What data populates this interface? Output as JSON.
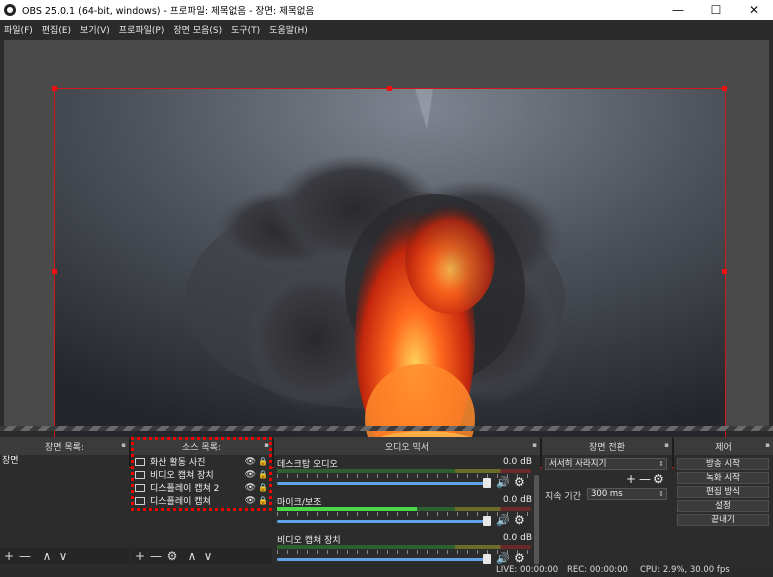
{
  "window": {
    "title": "OBS 25.0.1 (64-bit, windows) - 프로파일: 제목없음 - 장면: 제목없음",
    "minimize_glyph": "—",
    "maximize_glyph": "☐",
    "close_glyph": "✕"
  },
  "menu": [
    {
      "label": "파일(F)"
    },
    {
      "label": "편집(E)"
    },
    {
      "label": "보기(V)"
    },
    {
      "label": "프로파일(P)"
    },
    {
      "label": "장면 모음(S)"
    },
    {
      "label": "도구(T)"
    },
    {
      "label": "도움말(H)"
    }
  ],
  "preview": {
    "content": "volcano eruption photo"
  },
  "docks": {
    "scenes": {
      "header": "장면 목록:",
      "items": [
        "장면"
      ],
      "footer_add": "+",
      "footer_remove": "—",
      "footer_up": "∧",
      "footer_down": "∨"
    },
    "sources": {
      "header": "소스 목록:",
      "items": [
        {
          "label": "화산 활동 사진",
          "icon": "image-icon"
        },
        {
          "label": "비디오 캡쳐 장치",
          "icon": "camera-icon"
        },
        {
          "label": "디스플레이 캡쳐 2",
          "icon": "monitor-icon"
        },
        {
          "label": "디스플레이 캡쳐",
          "icon": "monitor-icon"
        }
      ],
      "footer_add": "+",
      "footer_remove": "—",
      "footer_settings": "⚙",
      "footer_up": "∧",
      "footer_down": "∨"
    },
    "mixer": {
      "header": "오디오 믹서",
      "channels": [
        {
          "name": "데스크탑 오디오",
          "db": "0.0 dB",
          "level": 0.0
        },
        {
          "name": "마이크/보조",
          "db": "0.0 dB",
          "level": 0.55
        },
        {
          "name": "비디오 캡쳐 장치",
          "db": "0.0 dB",
          "level": 0.0
        }
      ]
    },
    "transitions": {
      "header": "장면 전환",
      "selected": "서서히 사라지기",
      "duration_label": "지속 기간",
      "duration_value": "300 ms",
      "add": "+",
      "remove": "—",
      "settings": "⚙"
    },
    "controls": {
      "header": "제어",
      "buttons": [
        "방송 시작",
        "녹화 시작",
        "편집 방식",
        "설정",
        "끝내기"
      ]
    }
  },
  "status": {
    "live": "LIVE: 00:00:00",
    "rec": "REC: 00:00:00",
    "cpu": "CPU: 2.9%, 30.00 fps"
  },
  "colors": {
    "accent_red": "#d01818",
    "meter_green": "#49d849",
    "slider_blue": "#5ea2e8"
  }
}
